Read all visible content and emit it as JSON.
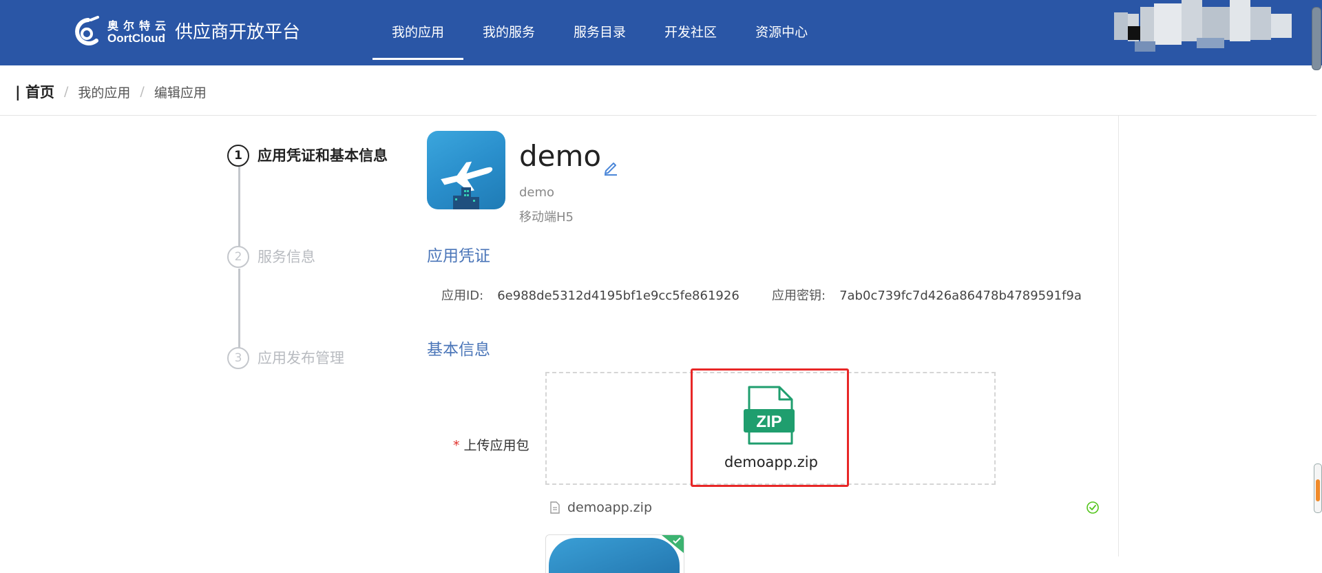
{
  "header": {
    "logo_cn": "奥尔特云",
    "logo_en": "OortCloud",
    "platform_title": "供应商开放平台",
    "nav": [
      {
        "label": "我的应用",
        "active": true
      },
      {
        "label": "我的服务",
        "active": false
      },
      {
        "label": "服务目录",
        "active": false
      },
      {
        "label": "开发社区",
        "active": false
      },
      {
        "label": "资源中心",
        "active": false
      }
    ],
    "brand_color": "#2a56a6"
  },
  "breadcrumb": {
    "home": "| 首页",
    "separator": "/",
    "items": [
      "我的应用",
      "编辑应用"
    ]
  },
  "steps": [
    {
      "number": "1",
      "label": "应用凭证和基本信息",
      "active": true
    },
    {
      "number": "2",
      "label": "服务信息",
      "active": false
    },
    {
      "number": "3",
      "label": "应用发布管理",
      "active": false
    }
  ],
  "app": {
    "icon": "airplane-city-icon",
    "name": "demo",
    "subtitle": "demo",
    "type": "移动端H5"
  },
  "credentials": {
    "title": "应用凭证",
    "app_id_label": "应用ID:",
    "app_id_value": "6e988de5312d4195bf1e9cc5fe861926",
    "app_secret_label": "应用密钥:",
    "app_secret_value": "7ab0c739fc7d426a86478b4789591f9a"
  },
  "basic_info": {
    "title": "基本信息",
    "upload": {
      "required_mark": "*",
      "label": "上传应用包",
      "file_icon": "zip-file-icon",
      "zip_badge": "ZIP",
      "file_name": "demoapp.zip",
      "uploaded_file": "demoapp.zip",
      "status_icon": "check-circle-icon"
    }
  },
  "colors": {
    "accent": "#4a75b8",
    "success": "#52c41a",
    "required": "#e0312b",
    "highlight": "#e82727",
    "zip_green": "#1f9e6e"
  }
}
